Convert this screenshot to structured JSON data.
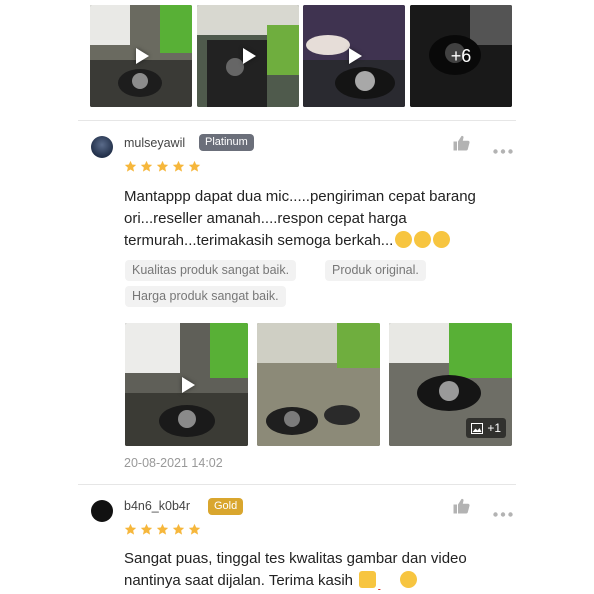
{
  "top_gallery": {
    "items": [
      {
        "type": "video"
      },
      {
        "type": "video"
      },
      {
        "type": "video"
      },
      {
        "type": "more",
        "label": "+6"
      }
    ]
  },
  "review1": {
    "username": "mulseyawil",
    "badge": "Platinum",
    "badge_color": "#6b6f7a",
    "rating": 5,
    "comment_line1": "Mantappp dapat dua mic.....pengiriman cepat barang",
    "comment_line2": "ori...reseller amanah....respon cepat harga",
    "comment_line3": "termurah...terimakasih semoga berkah...",
    "tags": [
      "Kualitas produk sangat baik.",
      "Produk original.",
      "Harga produk sangat baik."
    ],
    "media": [
      {
        "type": "video"
      },
      {
        "type": "image"
      },
      {
        "type": "image",
        "extra_label": "+1"
      }
    ],
    "date": "20-08-2021 14:02"
  },
  "review2": {
    "username": "b4n6_k0b4r",
    "badge": "Gold",
    "badge_color": "#d9a62e",
    "rating": 5,
    "comment_line1": "Sangat puas, tinggal tes kwalitas gambar dan video",
    "comment_line2": "nantinya saat dijalan. Terima kasih"
  },
  "colors": {
    "star": "#f6b73c",
    "icon_gray": "#b3b3b3",
    "divider": "#e6e6e6"
  }
}
